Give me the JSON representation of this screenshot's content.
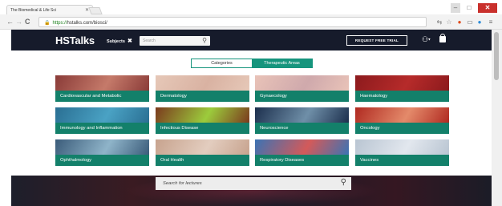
{
  "browser": {
    "tab_title": "HSTalks | The Biomedical & Life Sciences Collection",
    "tab_title_visible": "The Biomedical & Life Sci",
    "url_scheme": "https://",
    "url_rest": "hstalks.com/biosci/",
    "controls": {
      "back": "←",
      "forward": "→",
      "reload": "C",
      "minimize": "–",
      "maximize": "□",
      "close": "✕"
    },
    "extensions": [
      "translate-icon",
      "star-icon",
      "opera-icon",
      "print-icon",
      "skype-icon",
      "menu-icon"
    ]
  },
  "header": {
    "logo": "HSTalks",
    "subjects_label": "Subjects",
    "search_placeholder": "Search",
    "trial_button": "REQUEST FREE TRIAL"
  },
  "toggle": {
    "left": "Categories",
    "right": "Therapeutic Areas",
    "active": "right"
  },
  "areas": [
    {
      "label": "Cardiovascular and Metabolic",
      "icon": "cardiovascular-image",
      "c1": "#8a3b38",
      "c2": "#c57a6a"
    },
    {
      "label": "Dermatology",
      "icon": "dermatology-image",
      "c1": "#e6c8b8",
      "c2": "#d9b2a2"
    },
    {
      "label": "Gynaecology",
      "icon": "gynaecology-image",
      "c1": "#e9c3b8",
      "c2": "#cfa9ac"
    },
    {
      "label": "Haematology",
      "icon": "haematology-image",
      "c1": "#8c1a1d",
      "c2": "#b62b2a"
    },
    {
      "label": "Immunology and Inflammation",
      "icon": "immunology-image",
      "c1": "#2a6f93",
      "c2": "#4aa2c4"
    },
    {
      "label": "Infectious Disease",
      "icon": "infectious-disease-image",
      "c1": "#7b3a1e",
      "c2": "#9ccc3c"
    },
    {
      "label": "Neuroscience",
      "icon": "neuroscience-image",
      "c1": "#1c2f4d",
      "c2": "#6f8fa8"
    },
    {
      "label": "Oncology",
      "icon": "oncology-image",
      "c1": "#b02a21",
      "c2": "#e48a6a"
    },
    {
      "label": "Ophthalmology",
      "icon": "ophthalmology-image",
      "c1": "#3b5c7a",
      "c2": "#8fb4c9"
    },
    {
      "label": "Oral Health",
      "icon": "oral-health-image",
      "c1": "#c7a38e",
      "c2": "#e3cdbf"
    },
    {
      "label": "Respiratory Diseases",
      "icon": "respiratory-image",
      "c1": "#3b73b4",
      "c2": "#d35a5a"
    },
    {
      "label": "Vaccines",
      "icon": "vaccines-image",
      "c1": "#b9c5d2",
      "c2": "#e2e7ee"
    }
  ],
  "lecture_search": {
    "placeholder": "Search for lectures"
  }
}
